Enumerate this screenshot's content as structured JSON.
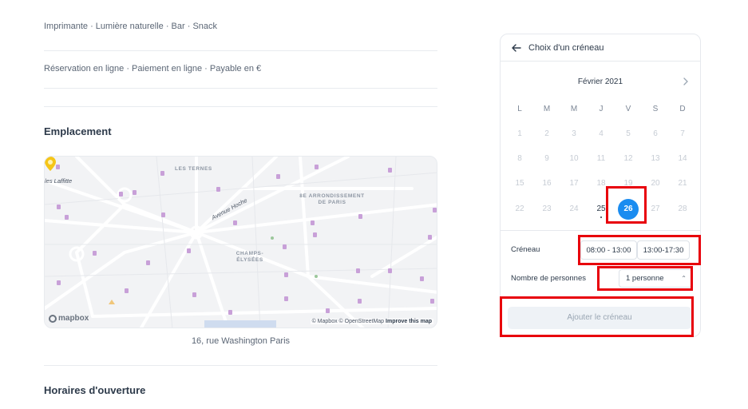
{
  "amenities": {
    "line": "Imprimante · Lumière naturelle · Bar · Snack"
  },
  "booking": {
    "line": "Réservation en ligne · Paiement en ligne · Payable en €"
  },
  "location": {
    "title": "Emplacement",
    "address": "16, rue Washington Paris",
    "map": {
      "labels": {
        "les_ternes": "LES TERNES",
        "laffitte": "les Laffitte",
        "avenue_hoche": "Avenue Hoche",
        "arrondissement": "8E ARRONDISSEMENT DE PARIS",
        "champs": "CHAMPS-ÉLYSÉES"
      },
      "logo": "mapbox",
      "attribution_mapbox": "© Mapbox",
      "attribution_osm": "© OpenStreetMap",
      "attribution_improve": "Improve this map",
      "pin_color": "#f5c518"
    }
  },
  "hours": {
    "title": "Horaires d'ouverture"
  },
  "slot_panel": {
    "title": "Choix d'un créneau",
    "back_icon": "arrow-left-icon",
    "next_icon": "chevron-right-icon",
    "calendar": {
      "month": "Février 2021",
      "weekdays": [
        "L",
        "M",
        "M",
        "J",
        "V",
        "S",
        "D"
      ],
      "weeks": [
        [
          "1",
          "2",
          "3",
          "4",
          "5",
          "6",
          "7"
        ],
        [
          "8",
          "9",
          "10",
          "11",
          "12",
          "13",
          "14"
        ],
        [
          "15",
          "16",
          "17",
          "18",
          "19",
          "20",
          "21"
        ],
        [
          "22",
          "23",
          "24",
          "25",
          "26",
          "27",
          "28"
        ]
      ],
      "today": "25",
      "selected": "26",
      "selected_color": "#1a8cf0"
    },
    "slot_label": "Créneau",
    "slots": [
      "08:00 - 13:00",
      "13:00-17:30"
    ],
    "people_label": "Nombre de personnes",
    "people_value": "1 personne",
    "add_button": "Ajouter le créneau"
  },
  "annotation_color": "#e8000b"
}
